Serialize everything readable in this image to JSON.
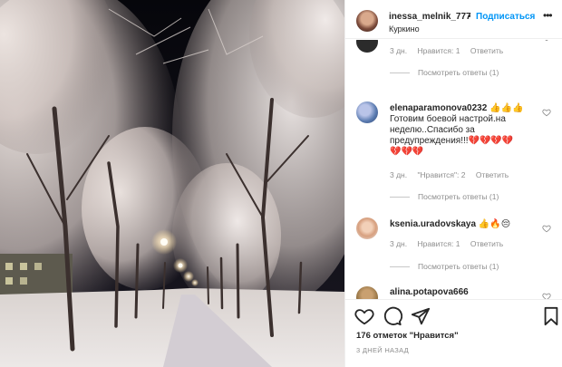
{
  "post": {
    "username": "inessa_melnik_777",
    "separator": "•",
    "follow_label": "Подписаться",
    "location": "Куркино",
    "more_label": "•••"
  },
  "comments": [
    {
      "username": "",
      "text": "",
      "time": "3 дн.",
      "likes": "Нравится: 1",
      "reply": "Ответить",
      "view_replies": "Посмотреть ответы (1)"
    },
    {
      "username": "elenaparamonova0232",
      "text_line1": "👍👍👍",
      "text_line2": "Готовим боевой настрой.на",
      "text_line3": "неделю..Спасибо за",
      "text_line4": "предупреждения!!!💔💔💔💔",
      "text_line5": "💔💔💔",
      "time": "3 дн.",
      "likes": "\"Нравится\": 2",
      "reply": "Ответить",
      "view_replies": "Посмотреть ответы (1)"
    },
    {
      "username": "ksenia.uradovskaya",
      "text": "👍🔥😔",
      "time": "3 дн.",
      "likes": "Нравится: 1",
      "reply": "Ответить",
      "view_replies": "Посмотреть ответы (1)"
    },
    {
      "username": "alina.potapova666"
    }
  ],
  "footer": {
    "likes_count": "176 отметок \"Нравится\"",
    "date": "3 ДНЕЙ НАЗАД"
  },
  "icons": {
    "like": "heart-icon",
    "comment": "comment-icon",
    "share": "share-icon",
    "save": "bookmark-icon"
  },
  "colors": {
    "accent": "#0095f6",
    "text": "#262626",
    "muted": "#8e8e8e"
  }
}
